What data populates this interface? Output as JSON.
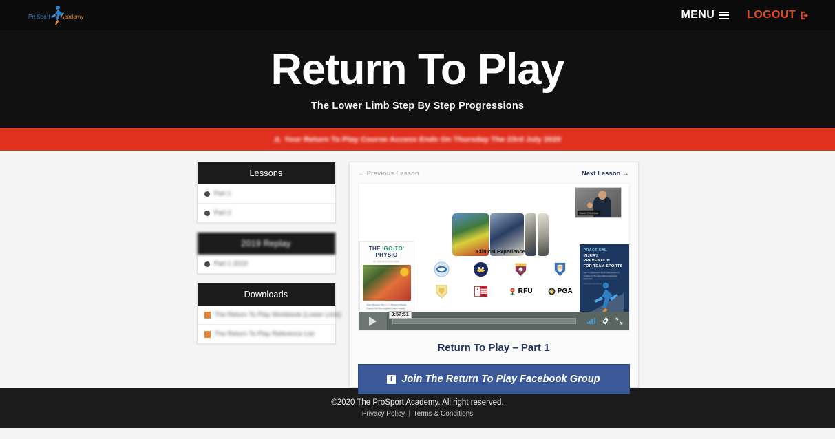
{
  "brand": {
    "logo_primary": "ProSport",
    "logo_secondary": "Academy",
    "logo_primary_color": "#2f7fc4",
    "logo_secondary_color": "#e8892b"
  },
  "topnav": {
    "menu_label": "MENU",
    "logout_label": "LOGOUT",
    "menu_icon": "hamburger-icon",
    "logout_icon": "logout-arrow-icon"
  },
  "hero": {
    "title": "Return To Play",
    "subtitle": "The Lower Limb Step By Step Progressions"
  },
  "alert": {
    "icon": "warning-triangle-icon",
    "text": "Your Return To Play Course Access Ends On Thursday The 23rd July 2020",
    "background": "#e0301e"
  },
  "sidebar": {
    "panels": [
      {
        "title": "Lessons",
        "title_blurred": false,
        "items": [
          {
            "icon": "status-dot-icon",
            "label": "Part 1"
          },
          {
            "icon": "status-dot-icon",
            "label": "Part 2"
          }
        ]
      },
      {
        "title": "2019 Replay",
        "title_blurred": true,
        "items": [
          {
            "icon": "status-dot-icon",
            "label": "Part 1 2019"
          }
        ]
      },
      {
        "title": "Downloads",
        "title_blurred": false,
        "items": [
          {
            "icon": "pdf-file-icon",
            "label": "The Return To Play Workbook (Lower Limb)"
          },
          {
            "icon": "pdf-file-icon",
            "label": "The Return To Play Reference List"
          }
        ]
      }
    ]
  },
  "main": {
    "prev_lesson": "← Previous Lesson",
    "next_lesson": "Next Lesson →",
    "lesson_title": "Return To Play – Part 1",
    "facebook_button": "Join The Return To Play Facebook Group",
    "facebook_icon": "facebook-f-icon"
  },
  "video": {
    "current_time": "3:57:51",
    "play_icon": "play-icon",
    "quality_icon": "signal-bars-icon",
    "settings_icon": "gear-icon",
    "fullscreen_icon": "fullscreen-icon",
    "presenter_name": "David O'Sullivan",
    "slide": {
      "clinical_heading": "Clinical Experience",
      "book_left": {
        "line1_a": "THE ",
        "line1_b": "'GO-TO'",
        "line2": "PHYSIO",
        "byline": "BY DAVID O'SULLIVAN",
        "caption_a": "How I Became The ",
        "caption_b": "Go-To",
        "caption_c": " Physio In Private Practice And With England Rugby League..."
      },
      "poster_right": {
        "line1": "PRACTICAL",
        "line2": "INJURY PREVENTION",
        "line3": "FOR TEAM SPORTS",
        "subtitle": "How To Implement A World Class System In Amateur Or Pro Sport Without Expensive Equipment",
        "byline": "Written By David O'Sullivan"
      },
      "crests": [
        {
          "name": "leeds-rhinos-crest",
          "color": "#cfe2f3"
        },
        {
          "name": "navy-club-crest",
          "color": "#1b2a5e"
        },
        {
          "name": "maroon-club-crest",
          "color": "#8e3a5c"
        },
        {
          "name": "blue-club-crest",
          "color": "#3a72b8"
        },
        {
          "name": "gold-club-crest",
          "color": "#e8c54a"
        },
        {
          "name": "england-rugby-league-crest",
          "color": "#b8202e"
        }
      ],
      "wordmarks": [
        {
          "name": "rfu-logo",
          "text": "RFU",
          "color": "#1b5e33"
        },
        {
          "name": "pga-logo",
          "text": "PGA",
          "color": "#1b2a4a"
        }
      ]
    }
  },
  "footer": {
    "copyright": "©2020 The ProSport Academy. All right reserved.",
    "privacy": "Privacy Policy",
    "separator": "|",
    "terms": "Terms & Conditions"
  }
}
